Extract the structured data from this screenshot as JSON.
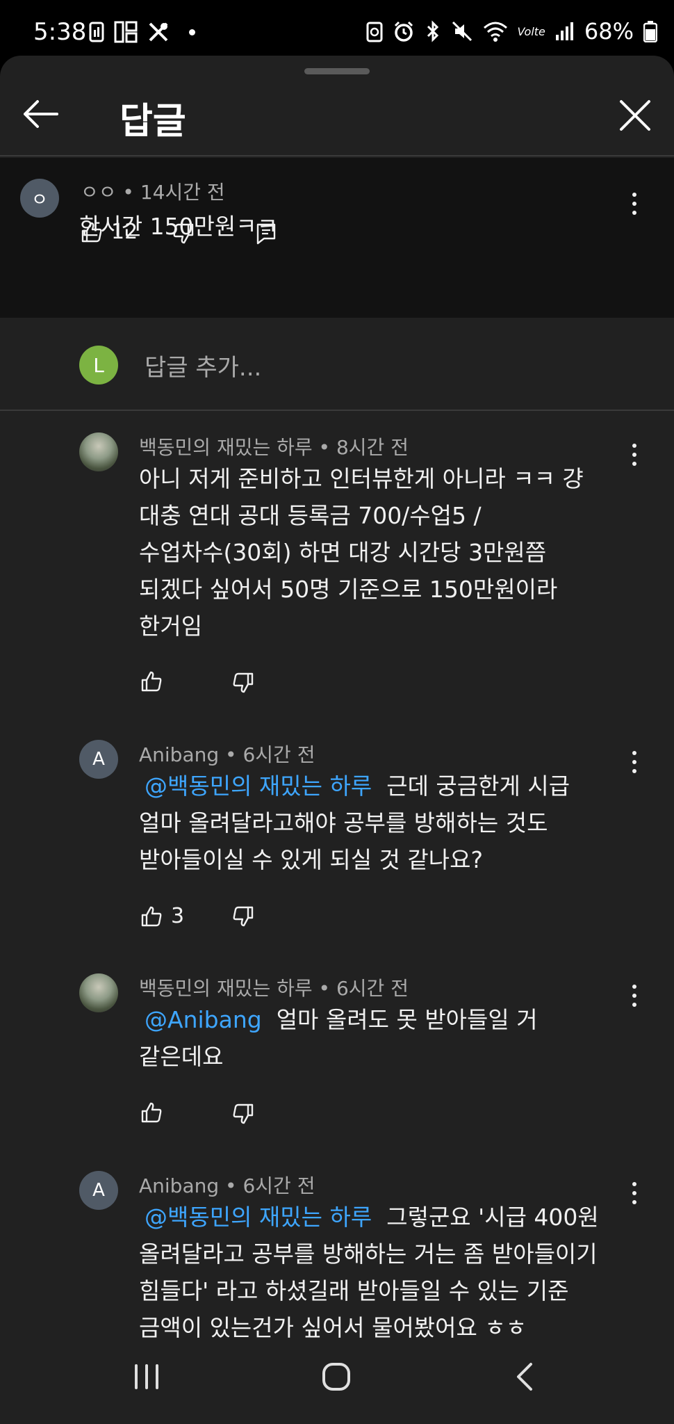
{
  "status_bar": {
    "time": "5:38",
    "battery": "68%",
    "network_label": "Volte"
  },
  "header": {
    "title": "답글"
  },
  "parent_comment": {
    "avatar_letter": "ㅇ",
    "author": "ㅇㅇ",
    "time": "14시간 전",
    "text": "한시간 150만원ㅋㅋ",
    "likes": "12"
  },
  "add_reply": {
    "avatar_letter": "L",
    "placeholder": "답글 추가..."
  },
  "replies": [
    {
      "author": "백동민의 재밌는 하루",
      "time": "8시간 전",
      "lines": [
        "아니 저게 준비하고 인터뷰한게 아니라 ㅋㅋ 걍",
        "대충 연대 공대 등록금 700/수업5 /",
        "수업차수(30회) 하면 대강 시간당 3만원쯤",
        "되겠다 싶어서 50명 기준으로 150만원이라",
        "한거임"
      ],
      "likes": ""
    },
    {
      "avatar_letter": "A",
      "author": "Anibang",
      "time": "6시간 전",
      "mention": "@백동민의 재밌는 하루",
      "first_line_rest": "근데 궁금한게 시급",
      "lines": [
        "얼마 올려달라고해야 공부를 방해하는 것도",
        "받아들이실 수 있게 되실 것 같나요?"
      ],
      "likes": "3"
    },
    {
      "author": "백동민의 재밌는 하루",
      "time": "6시간 전",
      "mention": "@Anibang",
      "first_line_rest": "얼마 올려도 못 받아들일 거",
      "lines": [
        "같은데요"
      ],
      "likes": ""
    },
    {
      "avatar_letter": "A",
      "author": "Anibang",
      "time": "6시간 전",
      "mention": "@백동민의 재밌는 하루",
      "first_line_rest": "그렇군요 '시급 400원",
      "lines": [
        "올려달라고 공부를 방해하는 거는 좀 받아들이기",
        "힘들다' 라고 하셨길래 받아들일 수 있는 기준",
        "금액이 있는건가 싶어서 물어봤어요 ㅎㅎ"
      ]
    }
  ],
  "colors": {
    "sheet_bg": "#212121",
    "parent_bg": "#121212",
    "mention": "#3ea6ff",
    "meta": "#aaaaaa",
    "avatar_a": "#505a66",
    "avatar_l": "#7cb342"
  },
  "icons": {
    "like": "thumb-up-icon",
    "dislike": "thumb-down-icon",
    "reply": "comment-icon",
    "more": "more-vert-icon"
  }
}
